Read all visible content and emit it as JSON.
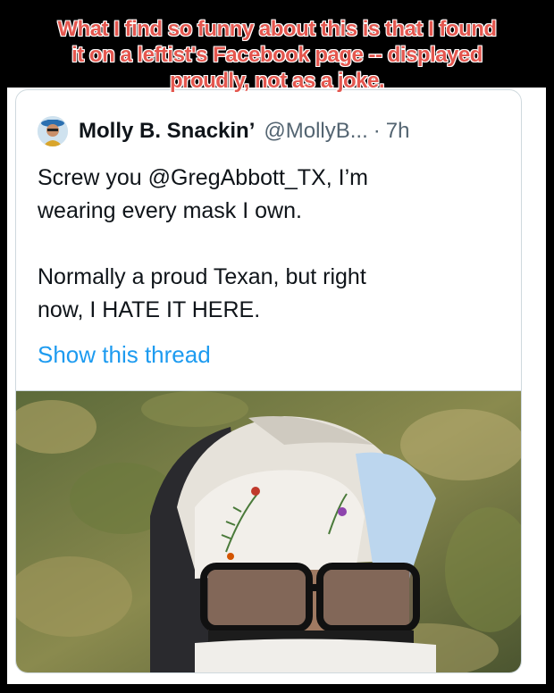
{
  "caption": {
    "lines": [
      "What I find so funny about this is that I found",
      "it on a leftist's Facebook page -- displayed",
      "proudly, not as a joke."
    ],
    "color": "#e4574f"
  },
  "tweet": {
    "display_name": "Molly B. Snackin’",
    "handle": "@MollyB...",
    "separator": "·",
    "time": "7h",
    "text_line_1": "Screw you @GregAbbott_TX, I’m",
    "text_line_2": "wearing every mask I own.",
    "text_line_3": "Normally a proud Texan, but right",
    "text_line_4": "now, I HATE IT HERE.",
    "show_thread": "Show this thread",
    "link_color": "#1d9bf0"
  },
  "media": {
    "alt_icon": "photo-person-wearing-masks"
  }
}
